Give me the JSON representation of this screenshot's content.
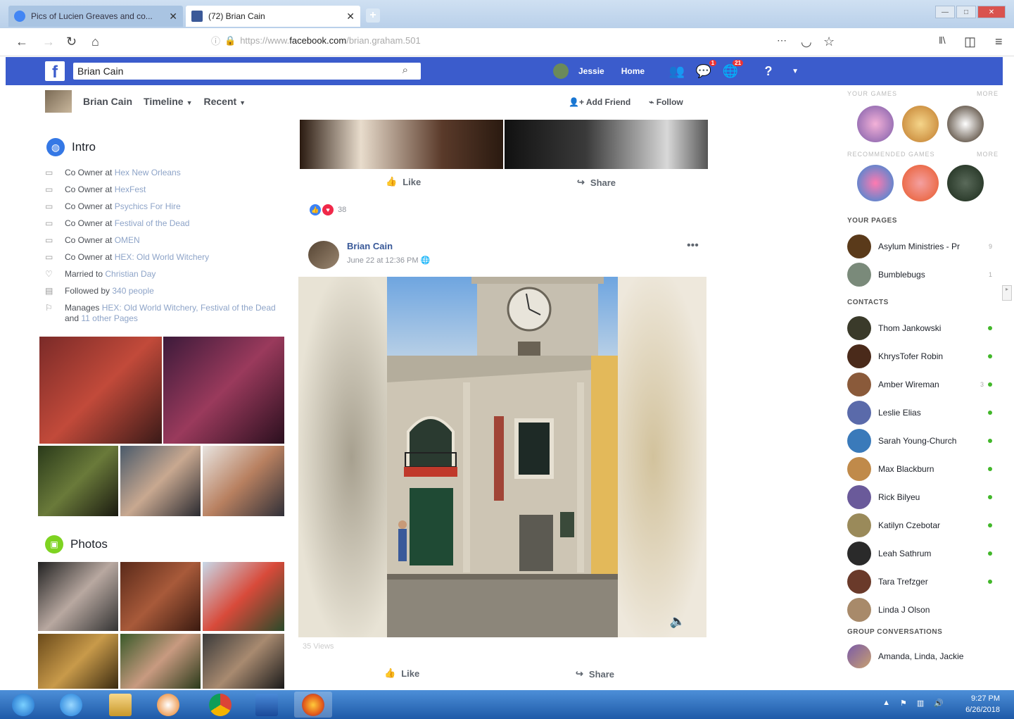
{
  "browser": {
    "tabs": [
      {
        "title": "Pics of Lucien Greaves and co..."
      },
      {
        "title": "(72) Brian Cain"
      }
    ],
    "url_prefix": "https://www.",
    "url_domain": "facebook.com",
    "url_path": "/brian.graham.501"
  },
  "fb": {
    "search_value": "Brian Cain",
    "user": "Jessie",
    "home": "Home",
    "badges": {
      "messages": "1",
      "notifications": "21"
    }
  },
  "profile": {
    "name": "Brian Cain",
    "timeline": "Timeline",
    "recent": "Recent",
    "add_friend": "Add Friend",
    "follow": "Follow"
  },
  "intro": {
    "title": "Intro",
    "items": [
      {
        "pre": "Co Owner at ",
        "link": "Hex New Orleans",
        "post": ""
      },
      {
        "pre": "Co Owner at ",
        "link": "HexFest",
        "post": ""
      },
      {
        "pre": "Co Owner at ",
        "link": "Psychics For Hire",
        "post": ""
      },
      {
        "pre": "Co Owner at ",
        "link": "Festival of the Dead",
        "post": ""
      },
      {
        "pre": "Co Owner at ",
        "link": "OMEN",
        "post": ""
      },
      {
        "pre": "Co Owner at ",
        "link": "HEX: Old World Witchery",
        "post": ""
      },
      {
        "pre": "Married to ",
        "link": "Christian Day",
        "post": ""
      },
      {
        "pre": "Followed by ",
        "link": "340 people",
        "post": ""
      }
    ],
    "manages_pre": "Manages ",
    "manages_link": "HEX: Old World Witchery, Festival of the Dead",
    "manages_and": " and ",
    "manages_other": "11 other Pages"
  },
  "photos": {
    "title": "Photos"
  },
  "post1": {
    "like": "Like",
    "share": "Share",
    "reaction_count": "38"
  },
  "post2": {
    "author": "Brian Cain",
    "time": "June 22 at 12:36 PM",
    "views": "35 Views",
    "like": "Like",
    "share": "Share"
  },
  "right": {
    "your_games": "YOUR GAMES",
    "more1": "MORE",
    "recommended_games": "RECOMMENDED GAMES",
    "more2": "MORE",
    "your_pages": "YOUR PAGES",
    "pages": [
      {
        "name": "Asylum Ministries - Pr",
        "count": "9"
      },
      {
        "name": "Bumblebugs",
        "count": "1"
      }
    ],
    "contacts_title": "CONTACTS",
    "contacts": [
      {
        "name": "Thom Jankowski",
        "count": ""
      },
      {
        "name": "KhrysTofer Robin",
        "count": ""
      },
      {
        "name": "Amber Wireman",
        "count": "3"
      },
      {
        "name": "Leslie Elias",
        "count": ""
      },
      {
        "name": "Sarah Young-Church",
        "count": ""
      },
      {
        "name": "Max Blackburn",
        "count": ""
      },
      {
        "name": "Rick Bilyeu",
        "count": ""
      },
      {
        "name": "Katilyn Czebotar",
        "count": ""
      },
      {
        "name": "Leah Sathrum",
        "count": ""
      },
      {
        "name": "Tara Trefzger",
        "count": ""
      },
      {
        "name": "Linda J Olson",
        "count": ""
      }
    ],
    "group_title": "GROUP CONVERSATIONS",
    "group": "Amanda, Linda, Jackie"
  },
  "taskbar": {
    "time": "9:27 PM",
    "date": "6/26/2018"
  },
  "colors": {
    "fb_blue": "#3b5ccc",
    "link": "#385898",
    "online": "#42b72a"
  }
}
